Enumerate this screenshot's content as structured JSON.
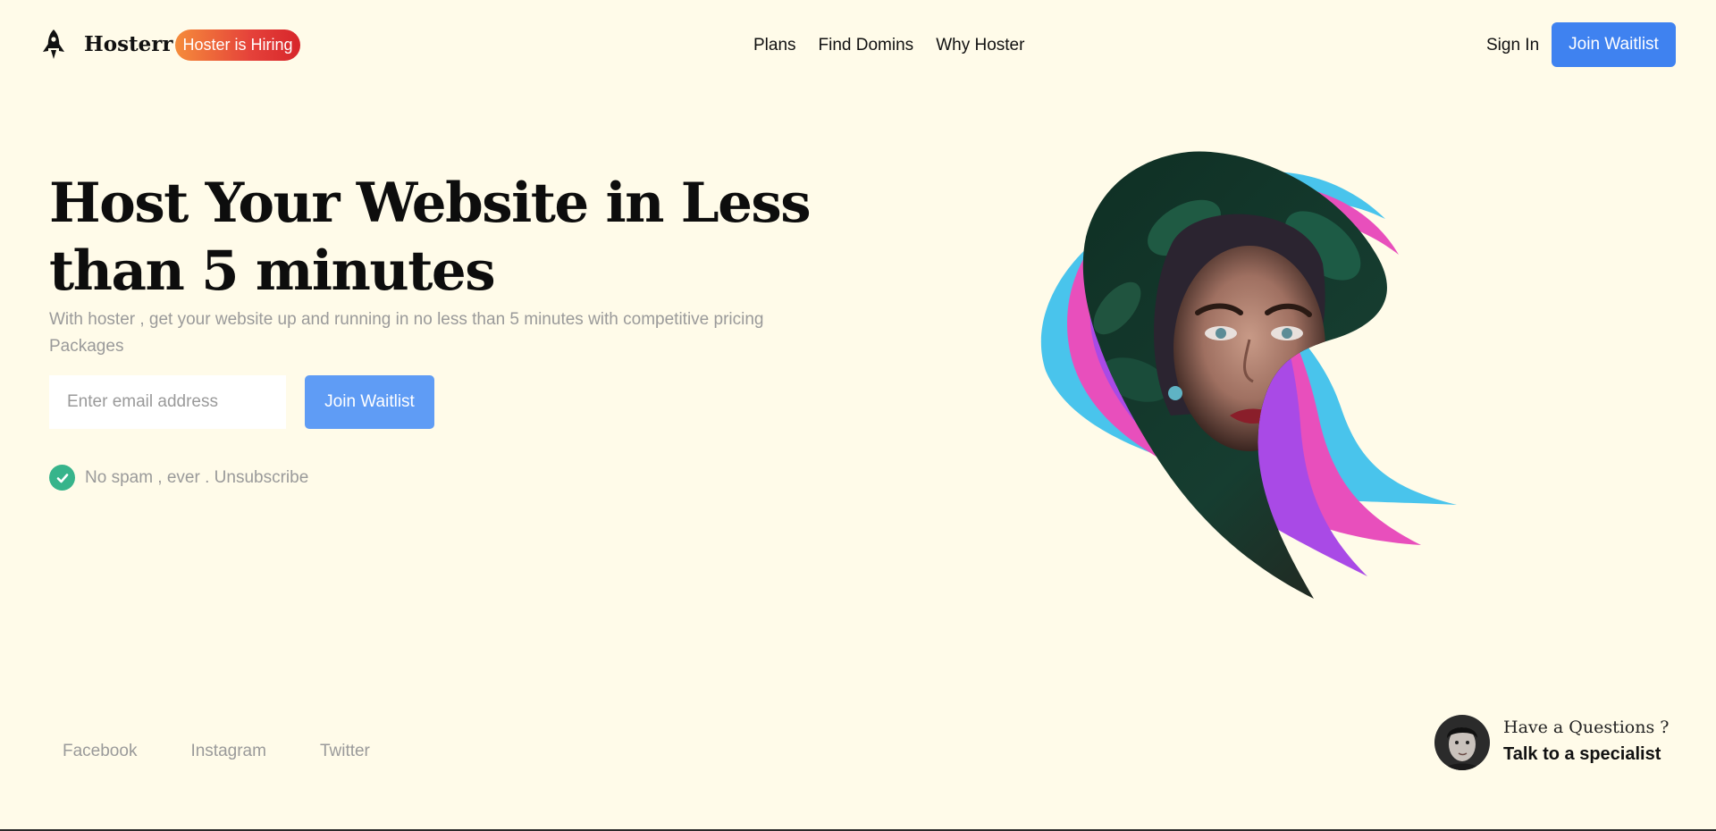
{
  "header": {
    "logo_icon": "rocket-icon",
    "brand": "Hosterr",
    "hiring_badge": "Hoster is Hiring",
    "nav": [
      "Plans",
      "Find Domins",
      "Why Hoster"
    ],
    "sign_in": "Sign In",
    "join_waitlist": "Join Waitlist"
  },
  "hero": {
    "title": "Host Your Website in Less than 5 minutes",
    "subtitle": "With hoster , get your website up and running in no less than 5 minutes with competitive pricing Packages",
    "email_placeholder": "Enter email address",
    "join_waitlist": "Join Waitlist",
    "no_spam": "No spam , ever . Unsubscribe",
    "no_spam_icon": "check-circle-icon"
  },
  "footer": {
    "social": [
      "Facebook",
      "Instagram",
      "Twitter"
    ],
    "help_question": "Have a Questions ?",
    "help_link": "Talk to a specialist"
  },
  "colors": {
    "background": "#fffbe9",
    "primary": "#3f82f0",
    "primary_light": "#5f9cf5",
    "badge_gradient_start": "#f58c3b",
    "badge_gradient_end": "#d7262b",
    "check": "#37b48b",
    "muted": "#9a9a9a",
    "swoosh_cyan": "#49c4ec",
    "swoosh_pink": "#e84fbc",
    "swoosh_purple": "#a94ae6"
  }
}
